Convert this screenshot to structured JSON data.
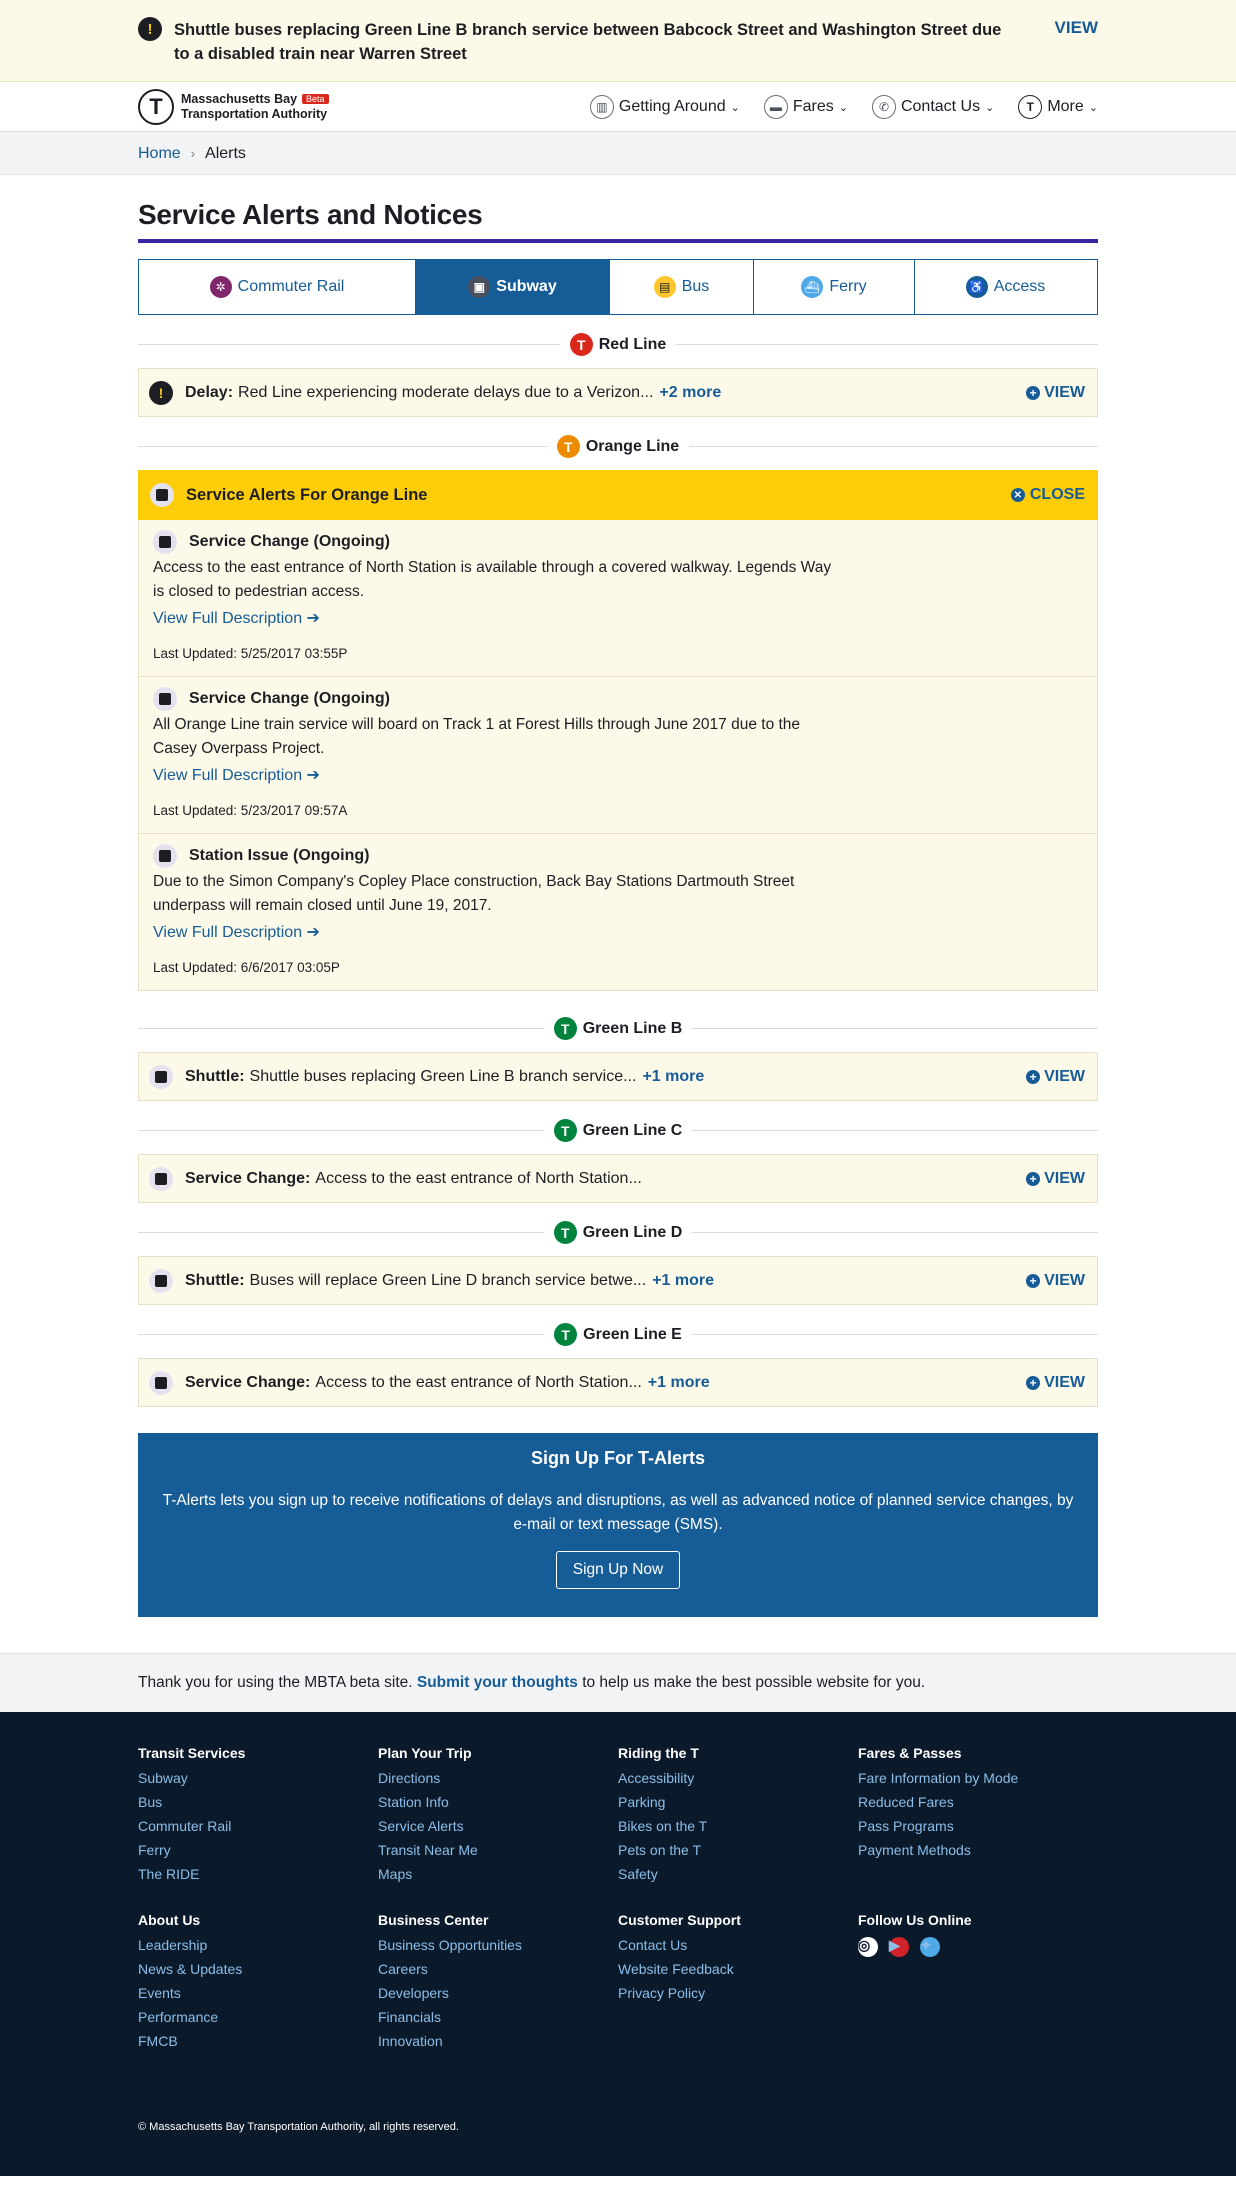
{
  "banner": {
    "icon": "warning-icon",
    "text": "Shuttle buses replacing Green Line B branch service between Babcock Street and Washington Street due to a disabled train near Warren Street",
    "view": "VIEW"
  },
  "header": {
    "logo_letter": "T",
    "org_line1": "Massachusetts Bay",
    "org_line2": "Transportation Authority",
    "beta": "Beta",
    "nav": [
      {
        "label": "Getting Around",
        "icon": "map-icon"
      },
      {
        "label": "Fares",
        "icon": "fare-card-icon"
      },
      {
        "label": "Contact Us",
        "icon": "phone-icon"
      },
      {
        "label": "More",
        "icon": "t-logo-icon"
      }
    ]
  },
  "breadcrumb": {
    "home": "Home",
    "current": "Alerts"
  },
  "page_title": "Service Alerts and Notices",
  "tabs": [
    {
      "label": "Commuter Rail",
      "color": "#80276c"
    },
    {
      "label": "Subway",
      "color": "#494f5c"
    },
    {
      "label": "Bus",
      "color": "#ffc72c"
    },
    {
      "label": "Ferry",
      "color": "#008eaa"
    },
    {
      "label": "Access",
      "color": "#165c96"
    }
  ],
  "red_line": {
    "name": "Red Line",
    "color": "#da291c",
    "alert": {
      "type": "Delay:",
      "text": "Red Line experiencing moderate delays due to a Verizon...",
      "more": "+2 more",
      "view": "VIEW"
    }
  },
  "orange_line": {
    "name": "Orange Line",
    "color": "#ed8b00",
    "header": "Service Alerts For Orange Line",
    "close": "CLOSE",
    "items": [
      {
        "title": "Service Change (Ongoing)",
        "desc": "Access to the east entrance of North Station is available through a covered walkway. Legends Way is closed to pedestrian access.",
        "link": "View Full Description",
        "updated": "Last Updated: 5/25/2017 03:55P"
      },
      {
        "title": "Service Change (Ongoing)",
        "desc": "All Orange Line train service will board on Track 1 at Forest Hills through June 2017 due to the Casey Overpass Project.",
        "link": "View Full Description",
        "updated": "Last Updated: 5/23/2017 09:57A"
      },
      {
        "title": "Station Issue (Ongoing)",
        "desc": "Due to the Simon Company's Copley Place construction, Back Bay Stations Dartmouth Street underpass will remain closed until June 19, 2017.",
        "link": "View Full Description",
        "updated": "Last Updated: 6/6/2017 03:05P"
      }
    ]
  },
  "green_b": {
    "name": "Green Line B",
    "color": "#00843d",
    "alert": {
      "type": "Shuttle:",
      "text": "Shuttle buses replacing Green Line B branch service...",
      "more": "+1 more",
      "view": "VIEW"
    }
  },
  "green_c": {
    "name": "Green Line C",
    "color": "#00843d",
    "alert": {
      "type": "Service Change:",
      "text": "Access to the east entrance of North Station...",
      "view": "VIEW"
    }
  },
  "green_d": {
    "name": "Green Line D",
    "color": "#00843d",
    "alert": {
      "type": "Shuttle:",
      "text": "Buses will replace Green Line D branch service betwe...",
      "more": "+1 more",
      "view": "VIEW"
    }
  },
  "green_e": {
    "name": "Green Line E",
    "color": "#00843d",
    "alert": {
      "type": "Service Change:",
      "text": "Access to the east entrance of North Station...",
      "more": "+1 more",
      "view": "VIEW"
    }
  },
  "signup": {
    "title": "Sign Up For T-Alerts",
    "text": "T-Alerts lets you sign up to receive notifications of delays and disruptions, as well as advanced notice of planned service changes, by e-mail or text message (SMS).",
    "button": "Sign Up Now"
  },
  "feedback": {
    "pre": "Thank you for using the MBTA beta site.",
    "link": "Submit your thoughts",
    "post": "to help us make the best possible website for you."
  },
  "footer": {
    "columns": [
      {
        "title": "Transit Services",
        "links": [
          "Subway",
          "Bus",
          "Commuter Rail",
          "Ferry",
          "The RIDE"
        ]
      },
      {
        "title": "Plan Your Trip",
        "links": [
          "Directions",
          "Station Info",
          "Service Alerts",
          "Transit Near Me",
          "Maps"
        ]
      },
      {
        "title": "Riding the T",
        "links": [
          "Accessibility",
          "Parking",
          "Bikes on the T",
          "Pets on the T",
          "Safety"
        ]
      },
      {
        "title": "Fares & Passes",
        "links": [
          "Fare Information by Mode",
          "Reduced Fares",
          "Pass Programs",
          "Payment Methods"
        ]
      },
      {
        "title": "About Us",
        "links": [
          "Leadership",
          "News & Updates",
          "Events",
          "Performance",
          "FMCB"
        ]
      },
      {
        "title": "Business Center",
        "links": [
          "Business Opportunities",
          "Careers",
          "Developers",
          "Financials",
          "Innovation"
        ]
      },
      {
        "title": "Customer Support",
        "links": [
          "Contact Us",
          "Website Feedback",
          "Privacy Policy"
        ]
      },
      {
        "title": "Follow Us Online",
        "social": [
          {
            "icon": "instagram-icon",
            "color": "#ffffff"
          },
          {
            "icon": "youtube-icon",
            "color": "#d2232a"
          },
          {
            "icon": "twitter-icon",
            "color": "#4fa9e8"
          }
        ]
      }
    ],
    "copyright": "© Massachusetts Bay Transportation Authority, all rights reserved."
  }
}
